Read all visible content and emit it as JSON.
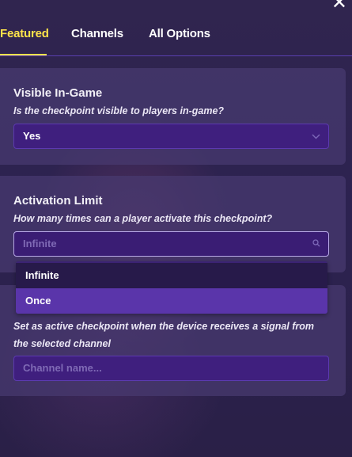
{
  "tabs": [
    {
      "label": "Featured",
      "active": true
    },
    {
      "label": "Channels",
      "active": false
    },
    {
      "label": "All Options",
      "active": false
    }
  ],
  "close_icon": "close-icon",
  "visible_ingame": {
    "title": "Visible In-Game",
    "description": "Is the checkpoint visible to players in-game?",
    "value": "Yes"
  },
  "activation_limit": {
    "title": "Activation Limit",
    "description": "How many times can a player activate this checkpoint?",
    "placeholder": "Infinite",
    "options": [
      "Infinite",
      "Once"
    ]
  },
  "active_channel": {
    "description_line1": "Set as active checkpoint when the device receives a signal from",
    "description_line2": "the selected channel",
    "placeholder": "Channel name..."
  },
  "colors": {
    "accent": "#ffe44a",
    "field_bg": "#3f1f7e",
    "selected_option": "#5a35aa"
  }
}
